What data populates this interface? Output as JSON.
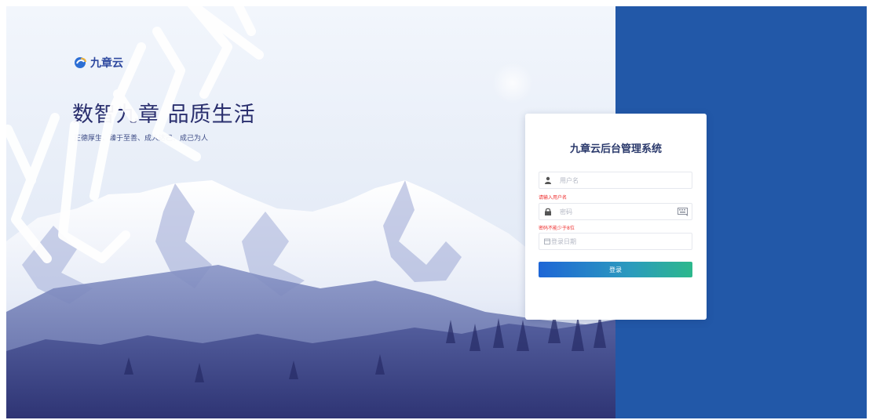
{
  "brand": {
    "logo_text": "九章云",
    "slogan": "数智九章 品质生活",
    "subslogan": "正德厚生、臻于至善、成人达己、成己为人"
  },
  "login": {
    "title": "九章云后台管理系统",
    "username_placeholder": "用户名",
    "username_error": "请输入用户名",
    "password_placeholder": "密码",
    "password_error": "密码不能少于8位",
    "date_placeholder": "登录日期",
    "submit_label": "登录"
  },
  "colors": {
    "panel_blue": "#2258a8",
    "accent_start": "#1e66d6",
    "accent_end": "#2cb88c",
    "error_red": "#ee2c2c"
  },
  "icons": {
    "username": "user-icon",
    "password": "lock-icon",
    "keyboard": "keyboard-icon",
    "date": "calendar-icon"
  }
}
